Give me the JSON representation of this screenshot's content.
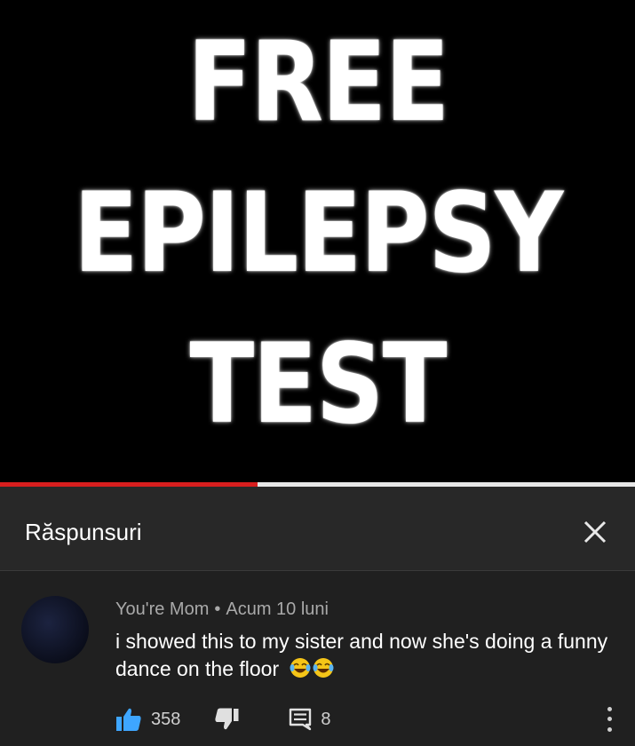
{
  "video": {
    "lines": [
      "FREE",
      "EPILEPSY",
      "TEST"
    ],
    "progress_fraction": 0.405
  },
  "panel": {
    "title": "Răspunsuri",
    "close_icon": "close-icon"
  },
  "comment": {
    "author": "You're Mom",
    "separator": "•",
    "time": "Acum 10 luni",
    "text": "i showed this to my sister and now she's doing a funny dance on the floor",
    "emoji_icon": "tears-of-joy-emoji",
    "likes": "358",
    "replies": "8"
  },
  "colors": {
    "accent_like": "#3ea6ff",
    "progress": "#d81e1e"
  }
}
